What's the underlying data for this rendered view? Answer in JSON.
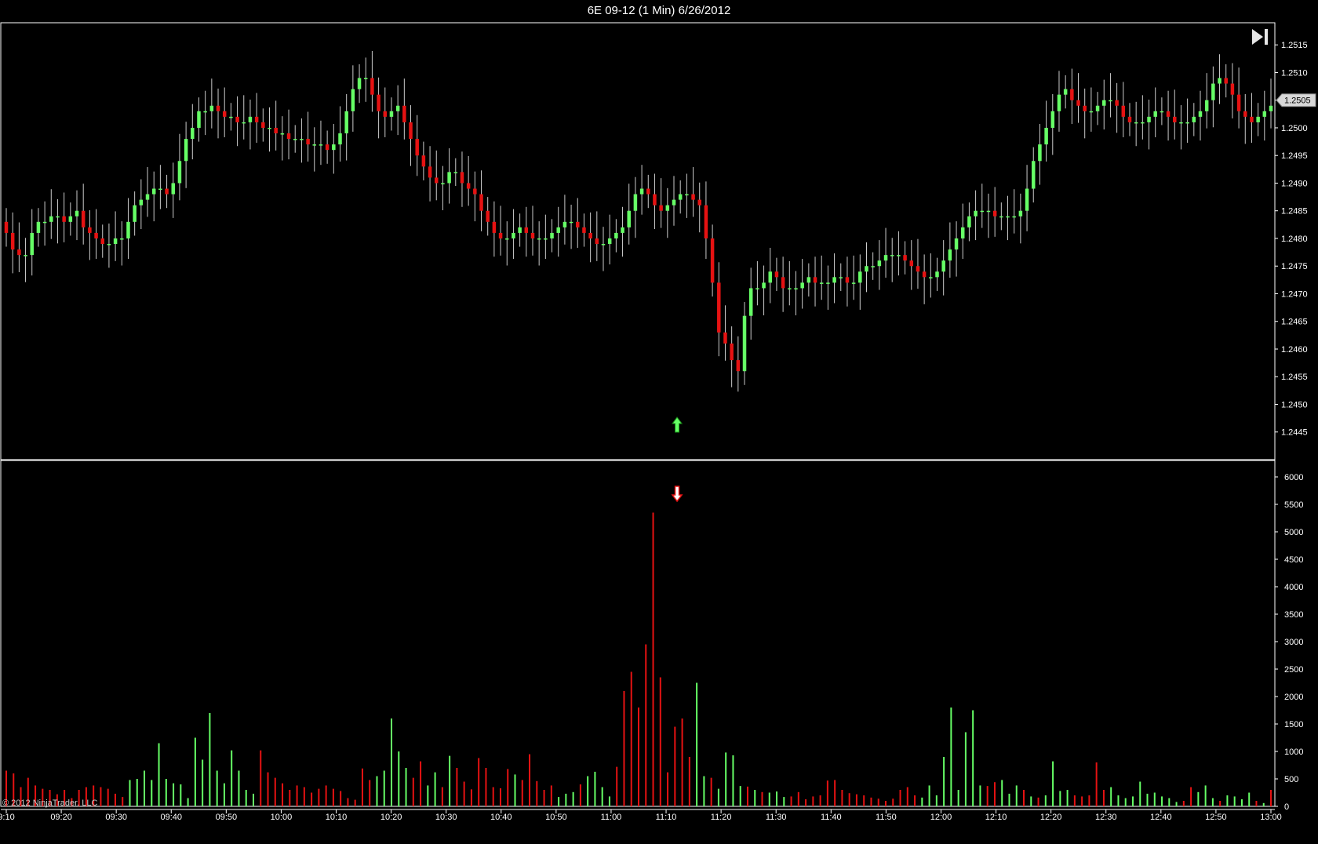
{
  "title": "6E 09-12 (1 Min)  6/26/2012",
  "copyright": "© 2012 NinjaTrader, LLC",
  "colors": {
    "background": "#000000",
    "up": "#66ff66",
    "down": "#e61212",
    "wick": "#cccccc",
    "border": "#ffffff",
    "axis_text": "#ffffff"
  },
  "icons": {
    "scroll_end": "skip-to-end-icon",
    "up_arrow": "green-up-arrow-icon",
    "down_arrow": "red-down-arrow-icon"
  },
  "chart_data": [
    {
      "type": "candlestick",
      "title": "6E 09-12 (1 Min)  6/26/2012",
      "ylim": [
        1.244,
        1.2519
      ],
      "y_ticks": [
        "1.2445",
        "1.2450",
        "1.2455",
        "1.2460",
        "1.2465",
        "1.2470",
        "1.2475",
        "1.2480",
        "1.2485",
        "1.2490",
        "1.2495",
        "1.2500",
        "1.2505",
        "1.2510",
        "1.2515"
      ],
      "last_price": "1.2505",
      "x_time_start": "09:10",
      "x_time_end": "13:00",
      "x_ticks": [
        "9:10",
        "09:20",
        "09:30",
        "09:40",
        "09:50",
        "10:00",
        "10:10",
        "10:20",
        "10:30",
        "10:40",
        "10:50",
        "11:00",
        "11:10",
        "11:20",
        "11:30",
        "11:40",
        "11:50",
        "12:00",
        "12:10",
        "12:20",
        "12:30",
        "12:40",
        "12:50",
        "13:00"
      ],
      "signal_up_arrow_time": "11:12",
      "close": [
        1.2481,
        1.2478,
        1.2477,
        1.2477,
        1.2481,
        1.2483,
        1.2483,
        1.2484,
        1.2484,
        1.2483,
        1.2484,
        1.2485,
        1.2482,
        1.2481,
        1.248,
        1.2479,
        1.2479,
        1.248,
        1.248,
        1.2483,
        1.2486,
        1.2487,
        1.2488,
        1.2489,
        1.2489,
        1.2488,
        1.249,
        1.2494,
        1.2498,
        1.25,
        1.2503,
        1.2503,
        1.2504,
        1.2503,
        1.2502,
        1.2502,
        1.2501,
        1.2501,
        1.2502,
        1.2501,
        1.25,
        1.25,
        1.2499,
        1.2499,
        1.2498,
        1.2498,
        1.2498,
        1.2497,
        1.2497,
        1.2497,
        1.2496,
        1.2497,
        1.2499,
        1.2503,
        1.2507,
        1.2509,
        1.2509,
        1.2506,
        1.2503,
        1.2502,
        1.2503,
        1.2504,
        1.2501,
        1.2498,
        1.2495,
        1.2493,
        1.2491,
        1.249,
        1.249,
        1.2492,
        1.2492,
        1.249,
        1.2489,
        1.2488,
        1.2485,
        1.2483,
        1.2481,
        1.248,
        1.248,
        1.2481,
        1.2482,
        1.2481,
        1.248,
        1.248,
        1.248,
        1.2481,
        1.2482,
        1.2483,
        1.2483,
        1.2482,
        1.2481,
        1.248,
        1.2479,
        1.2479,
        1.248,
        1.2481,
        1.2482,
        1.2485,
        1.2488,
        1.2489,
        1.2488,
        1.2486,
        1.2485,
        1.2486,
        1.2487,
        1.2488,
        1.2488,
        1.2487,
        1.2486,
        1.248,
        1.2472,
        1.2463,
        1.2461,
        1.2458,
        1.2456,
        1.2466,
        1.2471,
        1.2471,
        1.2472,
        1.2474,
        1.2473,
        1.2471,
        1.2471,
        1.2471,
        1.2472,
        1.2473,
        1.2472,
        1.2472,
        1.2472,
        1.2473,
        1.2473,
        1.2472,
        1.2472,
        1.2474,
        1.2475,
        1.2475,
        1.2476,
        1.2477,
        1.2477,
        1.2477,
        1.2476,
        1.2475,
        1.2474,
        1.2473,
        1.2473,
        1.2474,
        1.2476,
        1.2478,
        1.248,
        1.2482,
        1.2484,
        1.2485,
        1.2485,
        1.2485,
        1.2484,
        1.2484,
        1.2484,
        1.2484,
        1.2485,
        1.2489,
        1.2494,
        1.2497,
        1.25,
        1.2503,
        1.2506,
        1.2507,
        1.2505,
        1.2504,
        1.2503,
        1.2503,
        1.2504,
        1.2505,
        1.2505,
        1.2504,
        1.2502,
        1.2501,
        1.2501,
        1.2501,
        1.2502,
        1.2503,
        1.2503,
        1.2502,
        1.2501,
        1.2501,
        1.2501,
        1.2502,
        1.2503,
        1.2505,
        1.2508,
        1.2509,
        1.2508,
        1.2506,
        1.2503,
        1.2502,
        1.2501,
        1.2502,
        1.2503,
        1.2504
      ],
      "volume_panel": {
        "type": "bar",
        "ylim": [
          0,
          6300
        ],
        "y_ticks": [
          "0",
          "500",
          "1000",
          "1500",
          "2000",
          "2500",
          "3000",
          "3500",
          "4000",
          "4500",
          "5000",
          "5500",
          "6000"
        ],
        "signal_down_arrow_time": "11:12",
        "values": [
          650,
          600,
          350,
          520,
          380,
          320,
          300,
          220,
          300,
          150,
          300,
          350,
          380,
          350,
          320,
          230,
          170,
          480,
          500,
          650,
          480,
          1150,
          500,
          420,
          400,
          150,
          1250,
          850,
          1700,
          650,
          420,
          1020,
          650,
          300,
          230,
          1020,
          620,
          520,
          420,
          300,
          380,
          350,
          250,
          320,
          380,
          320,
          280,
          150,
          120,
          690,
          480,
          550,
          650,
          1600,
          1000,
          700,
          520,
          820,
          380,
          620,
          350,
          920,
          700,
          450,
          310,
          880,
          700,
          350,
          330,
          680,
          580,
          480,
          950,
          460,
          300,
          380,
          170,
          230,
          260,
          400,
          550,
          630,
          350,
          180,
          720,
          2100,
          2450,
          1800,
          2950,
          5350,
          2350,
          620,
          1450,
          1600,
          900,
          2250,
          550,
          520,
          320,
          980,
          930,
          370,
          360,
          300,
          260,
          250,
          270,
          170,
          180,
          260,
          130,
          180,
          200,
          470,
          480,
          300,
          240,
          220,
          200,
          160,
          140,
          100,
          140,
          300,
          350,
          200,
          160,
          380,
          200,
          900,
          1800,
          300,
          1350,
          1750,
          380,
          370,
          440,
          480,
          230,
          380,
          300,
          180,
          160,
          200,
          820,
          280,
          300,
          200,
          180,
          200,
          800,
          300,
          350,
          200,
          150,
          180,
          450,
          230,
          250,
          180,
          150,
          80,
          100,
          350,
          260,
          380,
          150,
          100,
          200,
          180,
          130,
          250,
          100,
          60,
          300
        ],
        "colors_by_bar": [
          "d",
          "d",
          "d",
          "d",
          "d",
          "d",
          "d",
          "d",
          "d",
          "d",
          "d",
          "d",
          "d",
          "d",
          "d",
          "d",
          "d",
          "u",
          "u",
          "u",
          "u",
          "u",
          "u",
          "u",
          "u",
          "u",
          "u",
          "u",
          "u",
          "u",
          "u",
          "u",
          "u",
          "u",
          "u",
          "d",
          "d",
          "d",
          "d",
          "d",
          "d",
          "d",
          "d",
          "d",
          "d",
          "d",
          "d",
          "d",
          "d",
          "d",
          "d",
          "u",
          "u",
          "u",
          "u",
          "u",
          "d",
          "d",
          "u",
          "u",
          "d",
          "u",
          "d",
          "d",
          "d",
          "d",
          "d",
          "d",
          "d",
          "d",
          "u",
          "d",
          "d",
          "d",
          "d",
          "d",
          "u",
          "u",
          "u",
          "d",
          "u",
          "u",
          "u",
          "u",
          "d",
          "d",
          "d",
          "d",
          "d",
          "d",
          "d",
          "d",
          "d",
          "d",
          "d",
          "u",
          "u",
          "d",
          "u",
          "u",
          "u",
          "u",
          "d",
          "u",
          "d",
          "u",
          "u",
          "u",
          "d",
          "d",
          "d",
          "d",
          "d",
          "d",
          "d",
          "d",
          "d",
          "d",
          "d",
          "d",
          "d",
          "d",
          "d",
          "d",
          "d",
          "d",
          "u",
          "u",
          "u",
          "u",
          "u",
          "u",
          "u",
          "u",
          "u",
          "d",
          "d",
          "u",
          "u",
          "u",
          "d",
          "u",
          "d",
          "u",
          "u",
          "u",
          "u",
          "d",
          "d",
          "d",
          "d",
          "d",
          "u",
          "u",
          "u",
          "u",
          "u",
          "u",
          "u",
          "u",
          "u",
          "u",
          "d",
          "d",
          "u",
          "u",
          "u",
          "d",
          "u",
          "u",
          "u",
          "u",
          "d",
          "u",
          "d",
          "d",
          "u",
          "u",
          "u",
          "u",
          "u",
          "d",
          "d",
          "d",
          "d",
          "d",
          "u",
          "u",
          "u"
        ]
      }
    }
  ]
}
